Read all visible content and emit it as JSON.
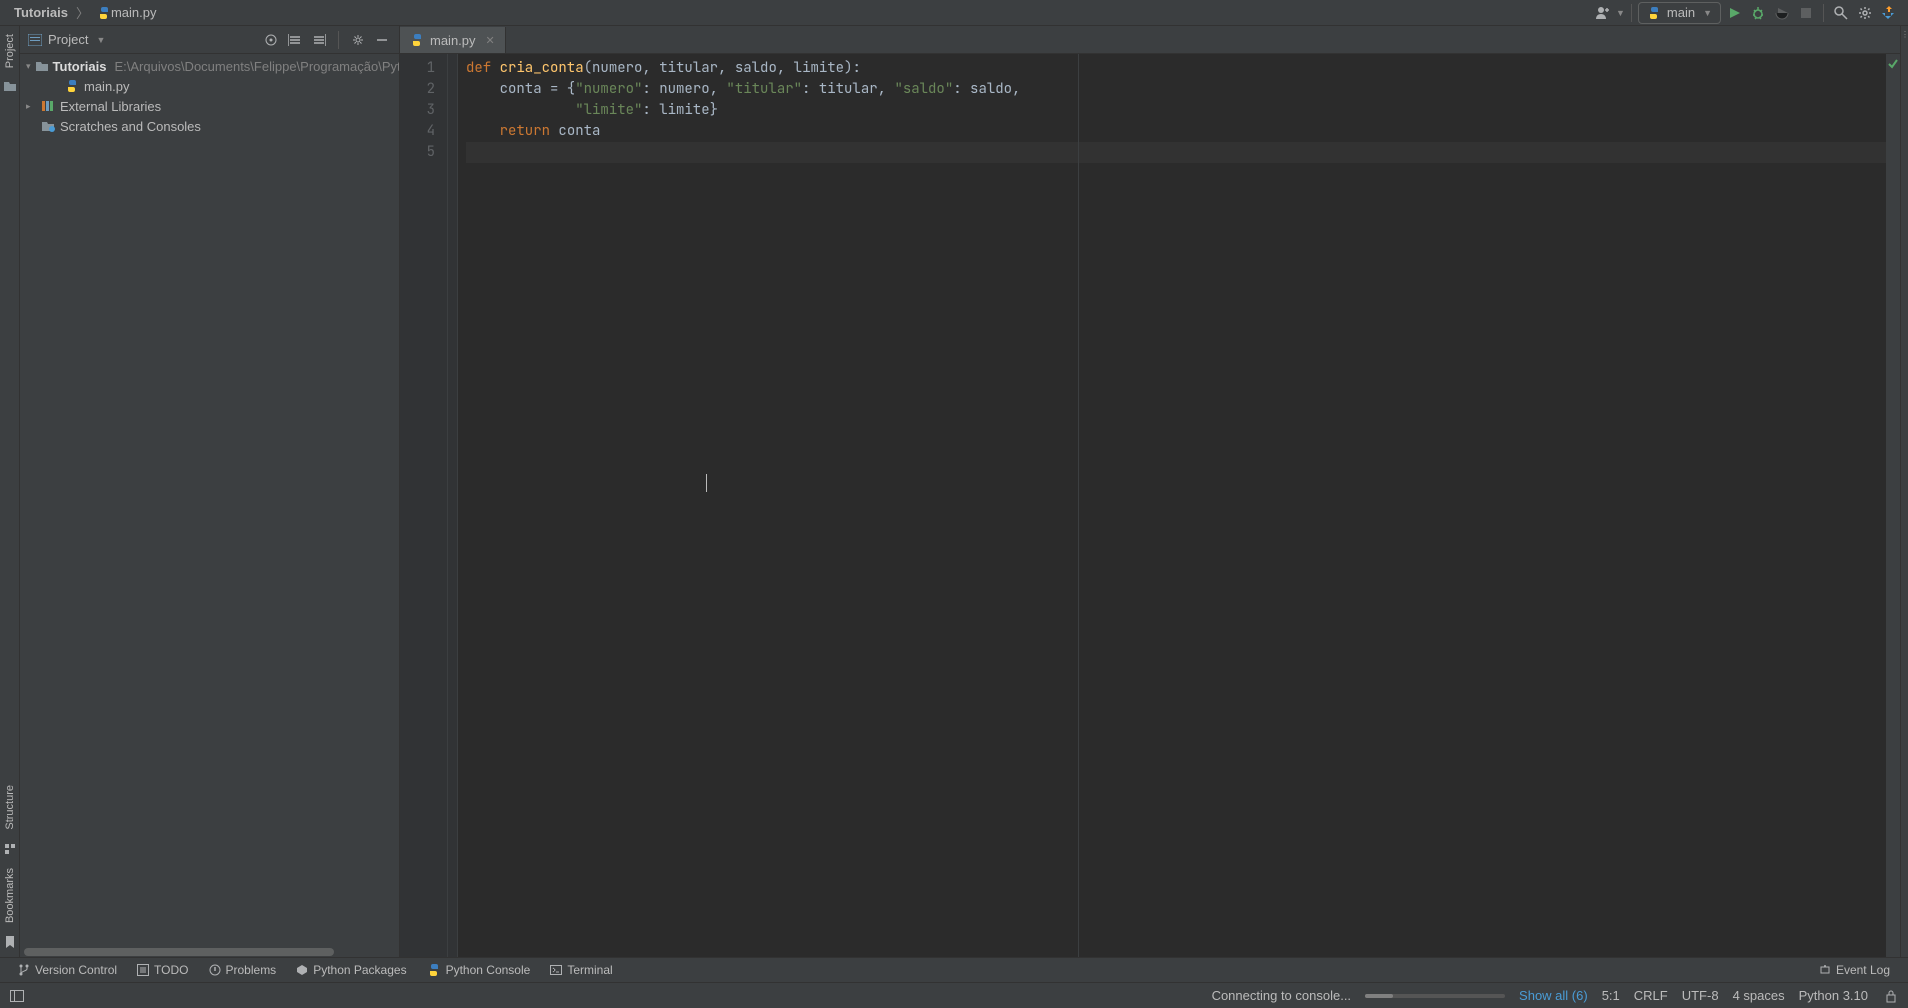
{
  "breadcrumb": {
    "project": "Tutoriais",
    "file": "main.py"
  },
  "toolbar": {
    "run_config": "main"
  },
  "project_panel": {
    "title": "Project",
    "root": {
      "name": "Tutoriais",
      "path": "E:\\Arquivos\\Documents\\Felippe\\Programação\\Pytl"
    },
    "file": "main.py",
    "external_libs": "External Libraries",
    "scratches": "Scratches and Consoles"
  },
  "editor": {
    "tab": "main.py",
    "lines": [
      "1",
      "2",
      "3",
      "4",
      "5"
    ],
    "code": [
      {
        "indent": "",
        "tokens": [
          {
            "t": "kw",
            "v": "def "
          },
          {
            "t": "fn",
            "v": "cria_conta"
          },
          {
            "t": "op",
            "v": "("
          },
          {
            "t": "param",
            "v": "numero"
          },
          {
            "t": "op",
            "v": ", "
          },
          {
            "t": "param",
            "v": "titular"
          },
          {
            "t": "op",
            "v": ", "
          },
          {
            "t": "param",
            "v": "saldo"
          },
          {
            "t": "op",
            "v": ", "
          },
          {
            "t": "param",
            "v": "limite"
          },
          {
            "t": "op",
            "v": "):"
          }
        ]
      },
      {
        "indent": "    ",
        "tokens": [
          {
            "t": "param",
            "v": "conta = {"
          },
          {
            "t": "str",
            "v": "\"numero\""
          },
          {
            "t": "op",
            "v": ": numero, "
          },
          {
            "t": "str",
            "v": "\"titular\""
          },
          {
            "t": "op",
            "v": ": titular, "
          },
          {
            "t": "str",
            "v": "\"saldo\""
          },
          {
            "t": "op",
            "v": ": saldo,"
          }
        ]
      },
      {
        "indent": "             ",
        "tokens": [
          {
            "t": "str",
            "v": "\"limite\""
          },
          {
            "t": "op",
            "v": ": limite}"
          }
        ]
      },
      {
        "indent": "    ",
        "tokens": [
          {
            "t": "kw",
            "v": "return "
          },
          {
            "t": "param",
            "v": "conta"
          }
        ]
      },
      {
        "indent": "",
        "tokens": [],
        "current": true
      }
    ]
  },
  "bottom": {
    "version_control": "Version Control",
    "todo": "TODO",
    "problems": "Problems",
    "python_packages": "Python Packages",
    "python_console": "Python Console",
    "terminal": "Terminal",
    "event_log": "Event Log"
  },
  "status": {
    "connecting": "Connecting to console...",
    "show_all": "Show all (6)",
    "caret": "5:1",
    "line_sep": "CRLF",
    "encoding": "UTF-8",
    "indent": "4 spaces",
    "interpreter": "Python 3.10"
  },
  "rail": {
    "project": "Project",
    "structure": "Structure",
    "bookmarks": "Bookmarks"
  }
}
